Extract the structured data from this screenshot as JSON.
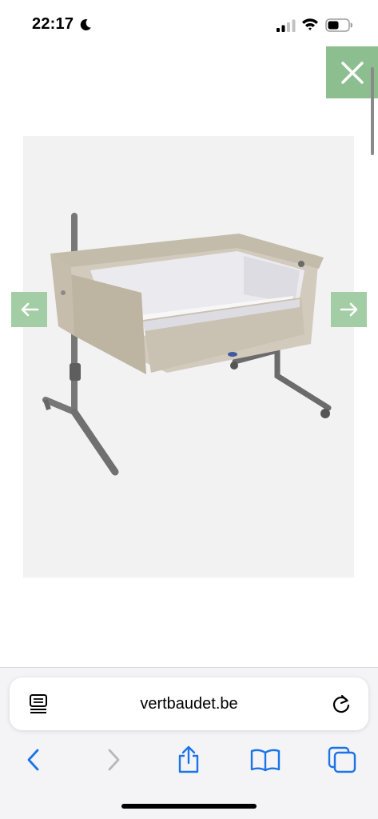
{
  "status_bar": {
    "time": "22:17",
    "moon_icon": "moon-icon",
    "signal_icon": "cellular-signal-icon",
    "wifi_icon": "wifi-icon",
    "battery_icon": "battery-icon"
  },
  "gallery": {
    "close_icon": "close-icon",
    "prev_icon": "arrow-left-icon",
    "next_icon": "arrow-right-icon",
    "accent_color": "#8dbe8f",
    "arrow_color": "#a3cea5",
    "image_subject": "bedside-crib-image"
  },
  "browser": {
    "url": "vertbaudet.be",
    "reader_icon": "reader-mode-icon",
    "reload_icon": "reload-icon",
    "back_icon": "back-chevron-icon",
    "forward_icon": "forward-chevron-icon",
    "share_icon": "share-icon",
    "bookmarks_icon": "bookmarks-icon",
    "tabs_icon": "tabs-icon",
    "accent_color": "#1a73e8"
  }
}
